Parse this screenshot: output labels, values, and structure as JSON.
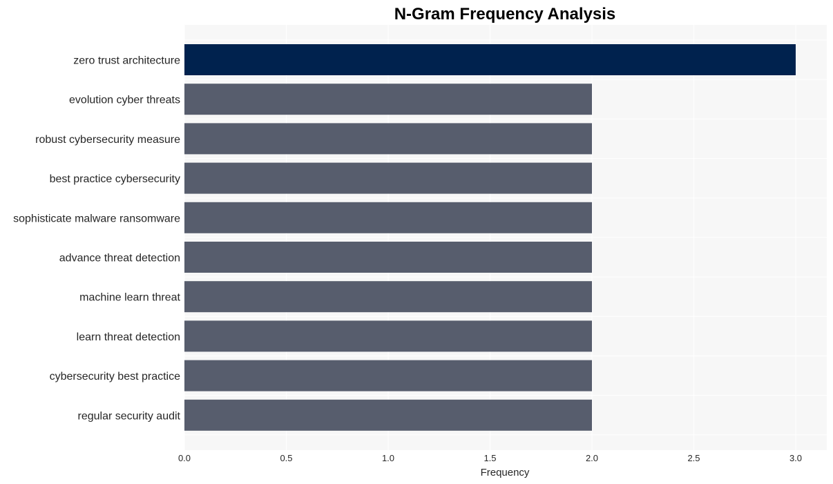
{
  "chart_data": {
    "type": "bar",
    "orientation": "horizontal",
    "title": "N-Gram Frequency Analysis",
    "xlabel": "Frequency",
    "ylabel": "",
    "xlim": [
      0,
      3.15
    ],
    "xticks": [
      "0.0",
      "0.5",
      "1.0",
      "1.5",
      "2.0",
      "2.5",
      "3.0"
    ],
    "xtick_values": [
      0,
      0.5,
      1.0,
      1.5,
      2.0,
      2.5,
      3.0
    ],
    "grid": true,
    "legend": "none",
    "categories": [
      "zero trust architecture",
      "evolution cyber threats",
      "robust cybersecurity measure",
      "best practice cybersecurity",
      "sophisticate malware ransomware",
      "advance threat detection",
      "machine learn threat",
      "learn threat detection",
      "cybersecurity best practice",
      "regular security audit"
    ],
    "values": [
      3,
      2,
      2,
      2,
      2,
      2,
      2,
      2,
      2,
      2
    ],
    "colors": {
      "highlight": "#00224e",
      "default": "#575d6d",
      "plot_background": "#f7f7f7",
      "grid": "#ffffff"
    }
  }
}
